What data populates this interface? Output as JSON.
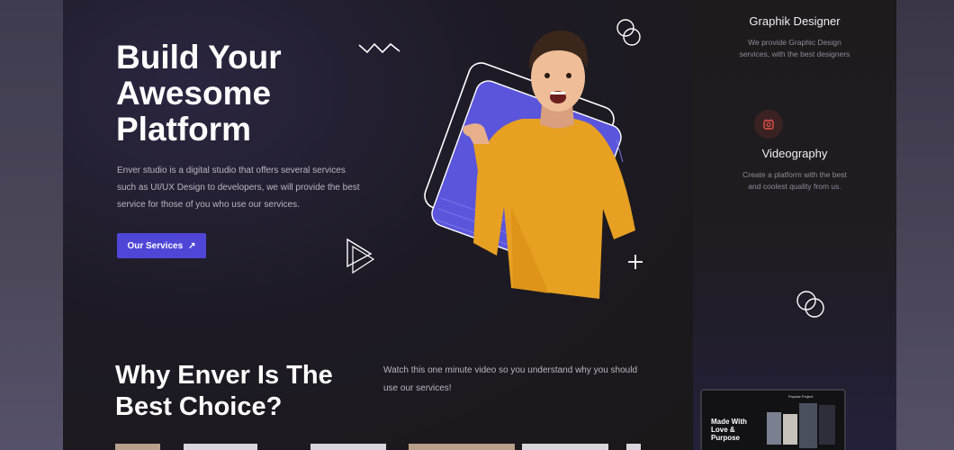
{
  "hero": {
    "title": "Build Your\nAwesome\nPlatform",
    "description": "Enver studio is a digital studio that offers several services such as UI/UX Design to developers, we will provide the best service for those of you who use our services.",
    "cta_label": "Our Services",
    "cta_icon": "arrow-up-right-icon"
  },
  "why_section": {
    "title": "Why Enver Is The\nBest Choice?",
    "description": "Watch this one minute video so you understand why you should use our services!"
  },
  "services": [
    {
      "title": "Graphik Designer",
      "description": "We provide Graphic Design services, with the best designers",
      "icon": "pen-icon"
    },
    {
      "title": "Videography",
      "description": "Create a platform with the best and coolest quality from us.",
      "icon": "video-icon"
    }
  ],
  "mockup": {
    "headline": "Made With Love & Purpose",
    "label": "Popular Project"
  },
  "colors": {
    "accent": "#4f46d8",
    "background": "#1b1819",
    "shirt": "#e7a022"
  }
}
